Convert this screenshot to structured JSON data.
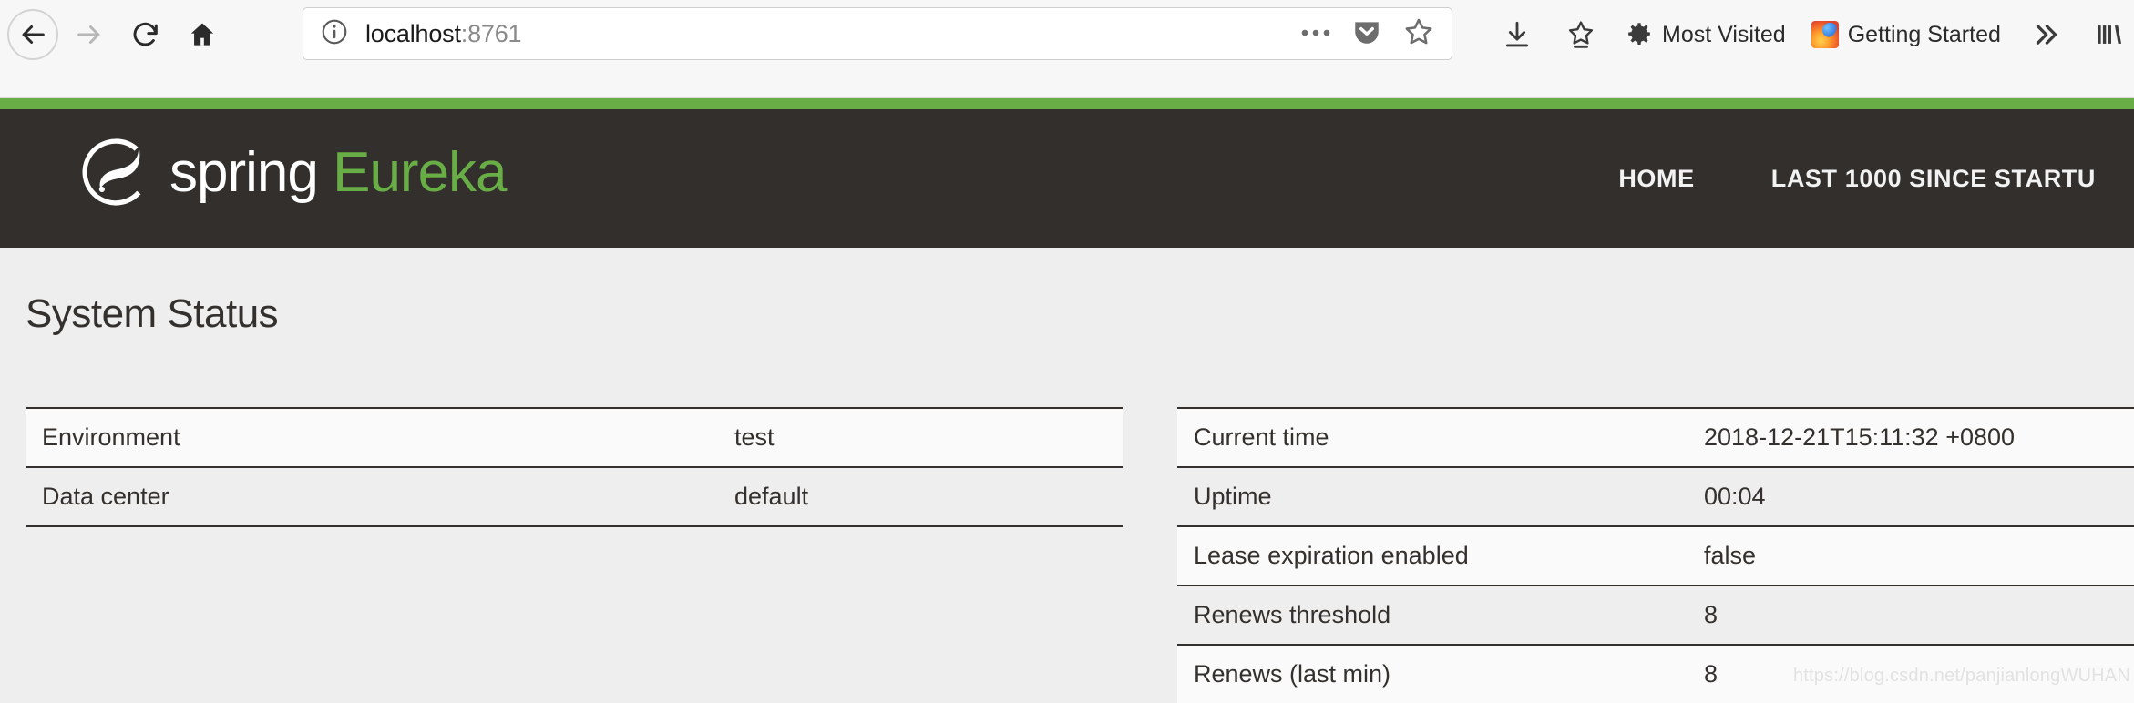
{
  "browser": {
    "nav": {
      "back_label": "Back",
      "forward_label": "Forward",
      "reload_label": "Reload",
      "home_label": "Home"
    },
    "urlbar": {
      "host": "localhost",
      "port": ":8761",
      "page_actions_label": "Page actions",
      "pocket_label": "Save to Pocket",
      "bookmark_label": "Bookmark this page"
    },
    "toolbar": {
      "downloads_label": "Downloads",
      "bookmark_star_label": "Bookmarks",
      "most_visited": "Most Visited",
      "getting_started": "Getting Started",
      "overflow_label": "»",
      "library_label": "Library"
    }
  },
  "eureka": {
    "brand": {
      "spring": "spring ",
      "eureka": "Eureka",
      "logo_color": "#ffffff",
      "accent_color": "#68ad45",
      "header_bg": "#322f2c"
    },
    "nav_links": [
      {
        "label": "HOME"
      },
      {
        "label": "LAST 1000 SINCE STARTU"
      }
    ]
  },
  "main": {
    "title": "System Status",
    "left_table": {
      "rows": [
        {
          "key": "Environment",
          "value": "test"
        },
        {
          "key": "Data center",
          "value": "default"
        }
      ]
    },
    "right_table": {
      "rows": [
        {
          "key": "Current time",
          "value": "2018-12-21T15:11:32 +0800"
        },
        {
          "key": "Uptime",
          "value": "00:04"
        },
        {
          "key": "Lease expiration enabled",
          "value": "false"
        },
        {
          "key": "Renews threshold",
          "value": "8"
        },
        {
          "key": "Renews (last min)",
          "value": "8"
        }
      ]
    },
    "watermark": "https://blog.csdn.net/panjianlongWUHAN"
  }
}
